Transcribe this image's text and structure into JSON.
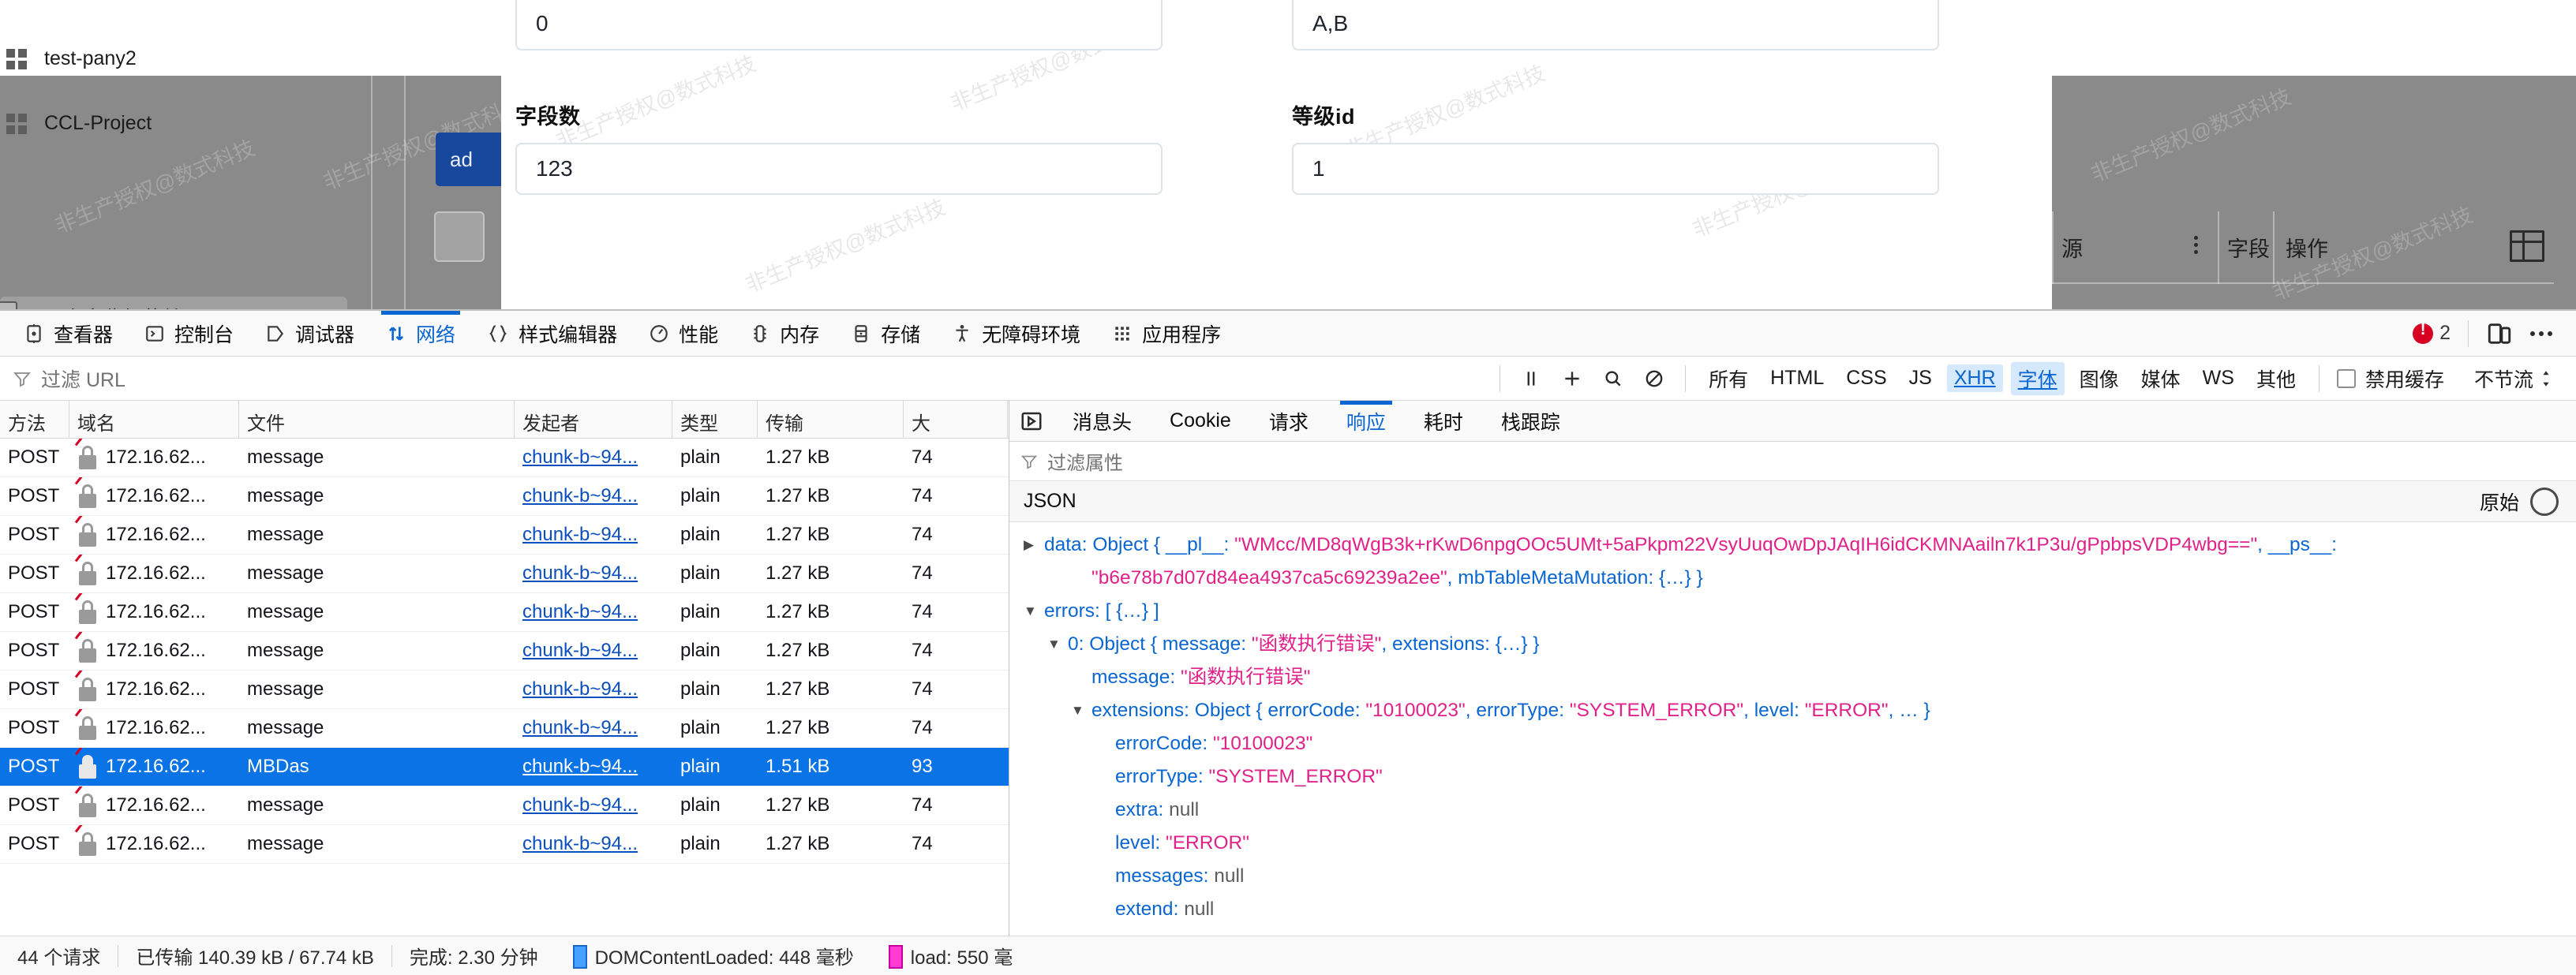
{
  "background_app": {
    "sidebar": {
      "items": [
        {
          "label": "test-pany2",
          "icon": "grid-icon"
        },
        {
          "label": "CCL-Project",
          "icon": "grid-icon"
        }
      ],
      "collapse_label": "点击收起菜单"
    },
    "add_button_label": "ad",
    "table_headers": [
      "源",
      "字段",
      "操作"
    ],
    "watermark": "非生产授权@数式科技"
  },
  "modal_form": {
    "fields": [
      {
        "label": "",
        "value": "0"
      },
      {
        "label": "",
        "value": "A,B"
      },
      {
        "label": "字段数",
        "value": "123"
      },
      {
        "label": "等级id",
        "value": "1"
      }
    ]
  },
  "devtools": {
    "tabs": [
      {
        "label": "查看器",
        "icon": "inspector-icon",
        "active": false
      },
      {
        "label": "控制台",
        "icon": "console-icon",
        "active": false
      },
      {
        "label": "调试器",
        "icon": "debugger-icon",
        "active": false
      },
      {
        "label": "网络",
        "icon": "network-icon",
        "active": true
      },
      {
        "label": "样式编辑器",
        "icon": "style-editor-icon",
        "active": false
      },
      {
        "label": "性能",
        "icon": "performance-icon",
        "active": false
      },
      {
        "label": "内存",
        "icon": "memory-icon",
        "active": false
      },
      {
        "label": "存储",
        "icon": "storage-icon",
        "active": false
      },
      {
        "label": "无障碍环境",
        "icon": "accessibility-icon",
        "active": false
      },
      {
        "label": "应用程序",
        "icon": "application-icon",
        "active": false
      }
    ],
    "error_count": "2",
    "filter_bar": {
      "url_placeholder": "过滤 URL",
      "types": [
        {
          "label": "所有",
          "active": false
        },
        {
          "label": "HTML",
          "active": false
        },
        {
          "label": "CSS",
          "active": false
        },
        {
          "label": "JS",
          "active": false
        },
        {
          "label": "XHR",
          "active": true
        },
        {
          "label": "字体",
          "active": true
        },
        {
          "label": "图像",
          "active": false
        },
        {
          "label": "媒体",
          "active": false
        },
        {
          "label": "WS",
          "active": false
        },
        {
          "label": "其他",
          "active": false
        }
      ],
      "disable_cache_label": "禁用缓存",
      "throttle_label": "不节流"
    },
    "request_table": {
      "headers": [
        "方法",
        "域名",
        "文件",
        "发起者",
        "类型",
        "传输",
        "大"
      ],
      "rows": [
        {
          "method": "POST",
          "domain": "172.16.62...",
          "file": "message",
          "initiator": "chunk-b~94...",
          "type": "plain",
          "transfer": "1.27 kB",
          "size": "74",
          "selected": false
        },
        {
          "method": "POST",
          "domain": "172.16.62...",
          "file": "message",
          "initiator": "chunk-b~94...",
          "type": "plain",
          "transfer": "1.27 kB",
          "size": "74",
          "selected": false
        },
        {
          "method": "POST",
          "domain": "172.16.62...",
          "file": "message",
          "initiator": "chunk-b~94...",
          "type": "plain",
          "transfer": "1.27 kB",
          "size": "74",
          "selected": false
        },
        {
          "method": "POST",
          "domain": "172.16.62...",
          "file": "message",
          "initiator": "chunk-b~94...",
          "type": "plain",
          "transfer": "1.27 kB",
          "size": "74",
          "selected": false
        },
        {
          "method": "POST",
          "domain": "172.16.62...",
          "file": "message",
          "initiator": "chunk-b~94...",
          "type": "plain",
          "transfer": "1.27 kB",
          "size": "74",
          "selected": false
        },
        {
          "method": "POST",
          "domain": "172.16.62...",
          "file": "message",
          "initiator": "chunk-b~94...",
          "type": "plain",
          "transfer": "1.27 kB",
          "size": "74",
          "selected": false
        },
        {
          "method": "POST",
          "domain": "172.16.62...",
          "file": "message",
          "initiator": "chunk-b~94...",
          "type": "plain",
          "transfer": "1.27 kB",
          "size": "74",
          "selected": false
        },
        {
          "method": "POST",
          "domain": "172.16.62...",
          "file": "message",
          "initiator": "chunk-b~94...",
          "type": "plain",
          "transfer": "1.27 kB",
          "size": "74",
          "selected": false
        },
        {
          "method": "POST",
          "domain": "172.16.62...",
          "file": "MBDas",
          "initiator": "chunk-b~94...",
          "type": "plain",
          "transfer": "1.51 kB",
          "size": "93",
          "selected": true
        },
        {
          "method": "POST",
          "domain": "172.16.62...",
          "file": "message",
          "initiator": "chunk-b~94...",
          "type": "plain",
          "transfer": "1.27 kB",
          "size": "74",
          "selected": false
        },
        {
          "method": "POST",
          "domain": "172.16.62...",
          "file": "message",
          "initiator": "chunk-b~94...",
          "type": "plain",
          "transfer": "1.27 kB",
          "size": "74",
          "selected": false
        }
      ]
    },
    "detail": {
      "tabs": [
        {
          "label": "消息头",
          "active": false
        },
        {
          "label": "Cookie",
          "active": false
        },
        {
          "label": "请求",
          "active": false
        },
        {
          "label": "响应",
          "active": true
        },
        {
          "label": "耗时",
          "active": false
        },
        {
          "label": "栈跟踪",
          "active": false
        }
      ],
      "filter_placeholder": "过滤属性",
      "section_label": "JSON",
      "raw_label": "原始",
      "json_rows": [
        {
          "indent": 0,
          "twisty": "collapsed",
          "parts": [
            {
              "t": "key",
              "v": "data"
            },
            {
              "t": "p",
              "v": ": "
            },
            {
              "t": "obj",
              "v": "Object { "
            },
            {
              "t": "key",
              "v": "__pl__"
            },
            {
              "t": "p",
              "v": ": "
            },
            {
              "t": "str",
              "v": "\"WMcc/MD8qWgB3k+rKwD6npgOOc5UMt+5aPkpm22VsyUuqOwDpJAqIH6idCKMNAailn7k1P3u/gPpbpsVDP4wbg==\""
            },
            {
              "t": "p",
              "v": ", "
            },
            {
              "t": "key",
              "v": "__ps__"
            },
            {
              "t": "p",
              "v": ":"
            }
          ]
        },
        {
          "indent": 2,
          "twisty": "none",
          "parts": [
            {
              "t": "str",
              "v": "\"b6e78b7d07d84ea4937ca5c69239a2ee\""
            },
            {
              "t": "p",
              "v": ", "
            },
            {
              "t": "key",
              "v": "mbTableMetaMutation"
            },
            {
              "t": "p",
              "v": ": "
            },
            {
              "t": "obj",
              "v": "{…} }"
            }
          ]
        },
        {
          "indent": 0,
          "twisty": "expanded",
          "parts": [
            {
              "t": "key",
              "v": "errors"
            },
            {
              "t": "p",
              "v": ": "
            },
            {
              "t": "obj",
              "v": "[ {…} ]"
            }
          ]
        },
        {
          "indent": 1,
          "twisty": "expanded",
          "parts": [
            {
              "t": "key",
              "v": "0"
            },
            {
              "t": "p",
              "v": ": "
            },
            {
              "t": "obj",
              "v": "Object { "
            },
            {
              "t": "key",
              "v": "message"
            },
            {
              "t": "p",
              "v": ": "
            },
            {
              "t": "str",
              "v": "\"函数执行错误\""
            },
            {
              "t": "p",
              "v": ", "
            },
            {
              "t": "key",
              "v": "extensions"
            },
            {
              "t": "p",
              "v": ": "
            },
            {
              "t": "obj",
              "v": "{…} }"
            }
          ]
        },
        {
          "indent": 2,
          "twisty": "none",
          "parts": [
            {
              "t": "key",
              "v": "message"
            },
            {
              "t": "p",
              "v": ": "
            },
            {
              "t": "str",
              "v": "\"函数执行错误\""
            }
          ]
        },
        {
          "indent": 2,
          "twisty": "expanded",
          "parts": [
            {
              "t": "key",
              "v": "extensions"
            },
            {
              "t": "p",
              "v": ": "
            },
            {
              "t": "obj",
              "v": "Object { "
            },
            {
              "t": "key",
              "v": "errorCode"
            },
            {
              "t": "p",
              "v": ": "
            },
            {
              "t": "str",
              "v": "\"10100023\""
            },
            {
              "t": "p",
              "v": ", "
            },
            {
              "t": "key",
              "v": "errorType"
            },
            {
              "t": "p",
              "v": ": "
            },
            {
              "t": "str",
              "v": "\"SYSTEM_ERROR\""
            },
            {
              "t": "p",
              "v": ", "
            },
            {
              "t": "key",
              "v": "level"
            },
            {
              "t": "p",
              "v": ": "
            },
            {
              "t": "str",
              "v": "\"ERROR\""
            },
            {
              "t": "p",
              "v": ", … }"
            }
          ]
        },
        {
          "indent": 3,
          "twisty": "none",
          "parts": [
            {
              "t": "key",
              "v": "errorCode"
            },
            {
              "t": "p",
              "v": ": "
            },
            {
              "t": "str",
              "v": "\"10100023\""
            }
          ]
        },
        {
          "indent": 3,
          "twisty": "none",
          "parts": [
            {
              "t": "key",
              "v": "errorType"
            },
            {
              "t": "p",
              "v": ": "
            },
            {
              "t": "str",
              "v": "\"SYSTEM_ERROR\""
            }
          ]
        },
        {
          "indent": 3,
          "twisty": "none",
          "parts": [
            {
              "t": "key",
              "v": "extra"
            },
            {
              "t": "p",
              "v": ": "
            },
            {
              "t": "null",
              "v": "null"
            }
          ]
        },
        {
          "indent": 3,
          "twisty": "none",
          "parts": [
            {
              "t": "key",
              "v": "level"
            },
            {
              "t": "p",
              "v": ": "
            },
            {
              "t": "str",
              "v": "\"ERROR\""
            }
          ]
        },
        {
          "indent": 3,
          "twisty": "none",
          "parts": [
            {
              "t": "key",
              "v": "messages"
            },
            {
              "t": "p",
              "v": ": "
            },
            {
              "t": "null",
              "v": "null"
            }
          ]
        },
        {
          "indent": 3,
          "twisty": "none",
          "parts": [
            {
              "t": "key",
              "v": "extend"
            },
            {
              "t": "p",
              "v": ": "
            },
            {
              "t": "null",
              "v": "null"
            }
          ]
        }
      ]
    },
    "status_bar": {
      "requests": "44 个请求",
      "transferred": "已传输 140.39 kB / 67.74 kB",
      "finish": "完成: 2.30 分钟",
      "dom_content_loaded": "DOMContentLoaded: 448 毫秒",
      "load": "load: 550 毫"
    }
  },
  "colors": {
    "accent_blue": "#0a66d0",
    "selection_blue": "#0a73e6",
    "error_red": "#d70022",
    "json_string_pink": "#e0218a",
    "brand_button_blue": "#17489e"
  }
}
